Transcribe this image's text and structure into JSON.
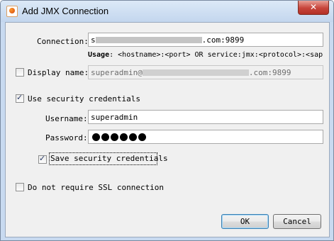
{
  "window": {
    "title": "Add JMX Connection",
    "close_glyph": "✕"
  },
  "connection": {
    "label": "Connection:",
    "value_suffix": ".com:9899",
    "value_prefix": "s"
  },
  "usage": {
    "label": "Usage",
    "text": ": <hostname>:<port> OR service:jmx:<protocol>:<sap"
  },
  "display_name": {
    "label": "Display name:",
    "value_prefix": "superadmin@",
    "value_suffix": ".com:9899",
    "checked": false
  },
  "security": {
    "label": "Use security credentials",
    "checked": true,
    "username_label": "Username:",
    "username_value": "superadmin",
    "password_label": "Password:",
    "password_length": 6,
    "save_label": "Save security credentials",
    "save_checked": true
  },
  "ssl": {
    "label": "Do not require SSL connection",
    "checked": false
  },
  "buttons": {
    "ok": "OK",
    "cancel": "Cancel"
  },
  "colors": {
    "title_bar": "#c8daf0",
    "close_button": "#c7443a",
    "dialog_background": "#f0f0f0",
    "default_button_border": "#3c7fb1"
  },
  "icons": [
    "app-icon",
    "close-icon",
    "checkbox-icon"
  ]
}
